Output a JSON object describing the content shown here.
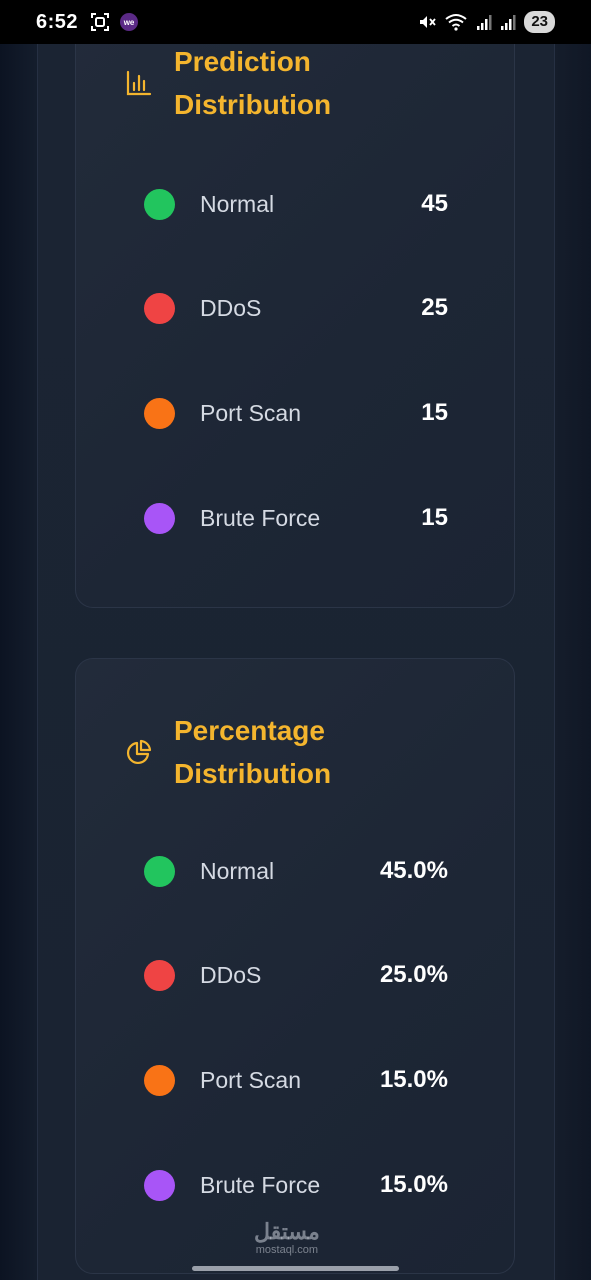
{
  "status_bar": {
    "time": "6:52",
    "carrier_badge": "we",
    "battery": "23",
    "icons": [
      "screenshot-icon",
      "mute-icon",
      "wifi-icon",
      "signal-icon",
      "signal-icon"
    ]
  },
  "prediction_card": {
    "title": "Prediction\nDistribution",
    "icon": "bar-chart-icon",
    "rows": [
      {
        "label": "Normal",
        "value": "45",
        "color": "#22c55e"
      },
      {
        "label": "DDoS",
        "value": "25",
        "color": "#ef4444"
      },
      {
        "label": "Port Scan",
        "value": "15",
        "color": "#f97316"
      },
      {
        "label": "Brute Force",
        "value": "15",
        "color": "#a855f7"
      }
    ]
  },
  "percentage_card": {
    "title": "Percentage\nDistribution",
    "icon": "pie-chart-icon",
    "rows": [
      {
        "label": "Normal",
        "value": "45.0%",
        "color": "#22c55e"
      },
      {
        "label": "DDoS",
        "value": "25.0%",
        "color": "#ef4444"
      },
      {
        "label": "Port Scan",
        "value": "15.0%",
        "color": "#f97316"
      },
      {
        "label": "Brute Force",
        "value": "15.0%",
        "color": "#a855f7"
      }
    ]
  },
  "watermark": {
    "arabic": "مستقل",
    "latin": "mostaql.com"
  },
  "accent_color": "#f4b52e"
}
